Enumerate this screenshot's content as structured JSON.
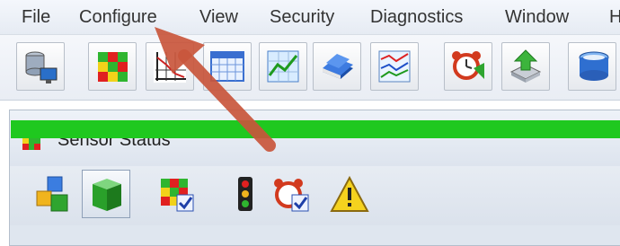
{
  "menubar": {
    "items": [
      "File",
      "Configure",
      "View",
      "Security",
      "Diagnostics",
      "Window",
      "H"
    ]
  },
  "toolbar": {
    "buttons": [
      {
        "name": "network-database-icon"
      },
      {
        "name": "sensor-grid-icon"
      },
      {
        "name": "graph-chart-icon"
      },
      {
        "name": "calendar-icon"
      },
      {
        "name": "line-chart-icon"
      },
      {
        "name": "book-icon"
      },
      {
        "name": "trend-chart-icon"
      },
      {
        "name": "alarm-clock-icon"
      },
      {
        "name": "export-tray-icon"
      },
      {
        "name": "database-icon"
      }
    ]
  },
  "subwindow": {
    "title": "Sensor Status",
    "buttons": [
      {
        "name": "blocks-icon",
        "active": false
      },
      {
        "name": "green-cube-icon",
        "active": true
      },
      {
        "name": "grid-check-icon",
        "active": false
      },
      {
        "name": "traffic-light-icon",
        "active": false
      },
      {
        "name": "alarm-check-icon",
        "active": false
      },
      {
        "name": "warning-icon",
        "active": false
      }
    ],
    "status_color": "#1fc81f"
  },
  "annotation": {
    "arrow_color": "#c9563c"
  }
}
